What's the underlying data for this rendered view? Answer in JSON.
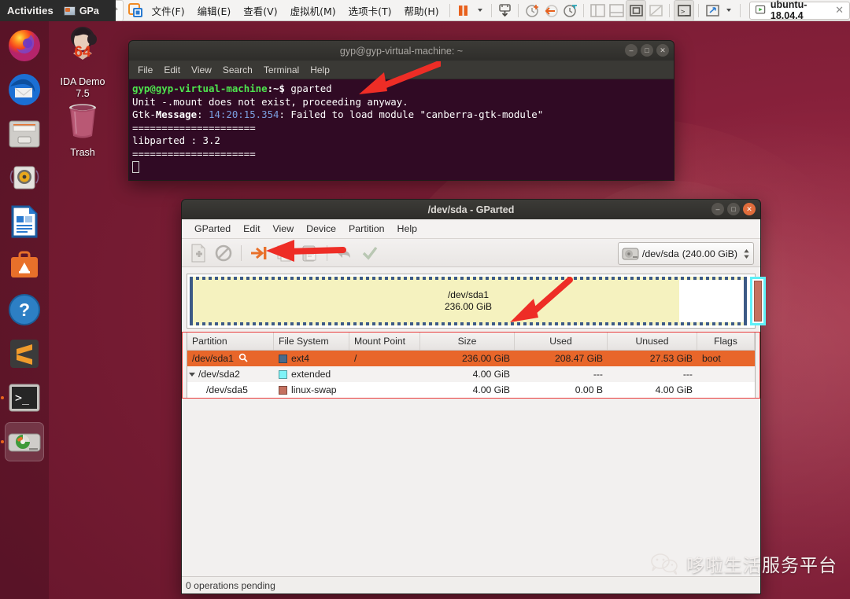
{
  "gnome_panel": {
    "activities": "Activities",
    "window_item": "GPa",
    "window_icon": "gparted-icon"
  },
  "vmware_toolbar": {
    "pin_icon": "pin-icon",
    "vmware_logo_icon": "vmware-logo-icon",
    "menus": [
      {
        "label": "文件(F)",
        "accel": "F"
      },
      {
        "label": "编辑(E)",
        "accel": "E"
      },
      {
        "label": "查看(V)",
        "accel": "V"
      },
      {
        "label": "虚拟机(M)",
        "accel": "M"
      },
      {
        "label": "选项卡(T)",
        "accel": "T"
      },
      {
        "label": "帮助(H)",
        "accel": "H"
      }
    ],
    "buttons": [
      {
        "name": "suspend-icon",
        "label": "Suspend"
      },
      {
        "name": "dropdown-caret-icon",
        "label": ""
      },
      {
        "name": "snapshot-icon",
        "label": "Take snapshot"
      },
      {
        "name": "manage-snapshots-icon",
        "label": "Manage snapshots"
      },
      {
        "name": "revert-snapshot-icon",
        "label": "Revert snapshot"
      },
      {
        "name": "snapshot-manager-icon",
        "label": "Snapshot manager"
      },
      {
        "name": "show-library-icon",
        "label": "Show library"
      },
      {
        "name": "show-thumbnails-icon",
        "label": "Show thumbnail bar"
      },
      {
        "name": "fullscreen-icon",
        "label": "Enter full screen"
      },
      {
        "name": "unity-mode-icon",
        "label": "Unity mode"
      },
      {
        "name": "console-icon",
        "label": "Console view"
      },
      {
        "name": "stretch-icon",
        "label": "Stretch guest"
      },
      {
        "name": "stretch-caret-icon",
        "label": ""
      }
    ],
    "tab": {
      "title": "ubuntu-18.04.4",
      "icon": "vm-running-icon",
      "close_icon": "close-icon"
    }
  },
  "dock": {
    "items": [
      {
        "name": "firefox",
        "label": "Firefox",
        "running": false
      },
      {
        "name": "thunderbird",
        "label": "Thunderbird Mail",
        "running": false
      },
      {
        "name": "files",
        "label": "Files",
        "running": false
      },
      {
        "name": "rhythmbox",
        "label": "Rhythmbox",
        "running": false
      },
      {
        "name": "libreoffice-writer",
        "label": "LibreOffice Writer",
        "running": false
      },
      {
        "name": "ubuntu-software",
        "label": "Ubuntu Software",
        "running": false
      },
      {
        "name": "help",
        "label": "Help",
        "running": false
      },
      {
        "name": "sublime-text",
        "label": "Sublime Text",
        "running": false
      },
      {
        "name": "terminal",
        "label": "Terminal",
        "running": true
      },
      {
        "name": "gparted",
        "label": "GParted",
        "running": true
      }
    ]
  },
  "desktop_icons": [
    {
      "name": "ida-demo",
      "label_line1": "IDA Demo",
      "label_line2": "7.5"
    },
    {
      "name": "trash",
      "label_line1": "Trash",
      "label_line2": ""
    }
  ],
  "terminal": {
    "title": "gyp@gyp-virtual-machine: ~",
    "menus": [
      "File",
      "Edit",
      "View",
      "Search",
      "Terminal",
      "Help"
    ],
    "prompt": "gyp@gyp-virtual-machine",
    "prompt_path": ":~$ ",
    "command": "gparted",
    "lines": [
      "Unit -.mount does not exist, proceeding anyway.",
      "=====================",
      "libparted : 3.2",
      "====================="
    ],
    "gtk_prefix": "Gtk-",
    "gtk_message_word": "Message",
    "gtk_time": "14:20:15.354",
    "gtk_rest": ": Failed to load module \"canberra-gtk-module\"",
    "window_buttons": [
      "minimize",
      "maximize",
      "close"
    ]
  },
  "gparted": {
    "title": "/dev/sda - GParted",
    "menus": [
      "GParted",
      "Edit",
      "View",
      "Device",
      "Partition",
      "Help"
    ],
    "toolbar": [
      {
        "name": "new-partition-icon",
        "label": "New",
        "enabled": false
      },
      {
        "name": "delete-partition-icon",
        "label": "Delete",
        "enabled": false
      },
      {
        "name": "resize-move-icon",
        "label": "Resize/Move",
        "enabled": true
      },
      {
        "name": "copy-icon",
        "label": "Copy",
        "enabled": false
      },
      {
        "name": "paste-icon",
        "label": "Paste",
        "enabled": false
      },
      {
        "name": "undo-icon",
        "label": "Undo",
        "enabled": false
      },
      {
        "name": "apply-icon",
        "label": "Apply",
        "enabled": false
      }
    ],
    "device_selector": {
      "icon": "harddisk-icon",
      "device": "/dev/sda",
      "size": "(240.00 GiB)",
      "spinner_icon": "spinner-updown-icon"
    },
    "graphic": {
      "partition_label": "/dev/sda1",
      "partition_size": "236.00 GiB",
      "used_gib": 208.47,
      "total_gib": 236.0,
      "extended_name": "/dev/sda2",
      "swap_name": "/dev/sda5"
    },
    "table": {
      "headers": [
        "Partition",
        "File System",
        "Mount Point",
        "Size",
        "Used",
        "Unused",
        "Flags"
      ],
      "rows": [
        {
          "partition": "/dev/sda1",
          "has_key_icon": true,
          "indent": 0,
          "expander": false,
          "fs": "ext4",
          "fs_color": "#4a6a8a",
          "mount": "/",
          "size": "236.00 GiB",
          "used": "208.47 GiB",
          "unused": "27.53 GiB",
          "flags": "boot",
          "selected": true
        },
        {
          "partition": "/dev/sda2",
          "has_key_icon": false,
          "indent": 0,
          "expander": true,
          "fs": "extended",
          "fs_color": "#7ff3f7",
          "mount": "",
          "size": "4.00 GiB",
          "used": "---",
          "unused": "---",
          "flags": "",
          "selected": false
        },
        {
          "partition": "/dev/sda5",
          "has_key_icon": false,
          "indent": 1,
          "expander": false,
          "fs": "linux-swap",
          "fs_color": "#c4705f",
          "mount": "",
          "size": "4.00 GiB",
          "used": "0.00 B",
          "unused": "4.00 GiB",
          "flags": "",
          "selected": false
        }
      ]
    },
    "status": "0 operations pending",
    "window_buttons": [
      "minimize",
      "maximize",
      "close"
    ]
  },
  "annotations": {
    "arrow_terminal": "red-arrow-pointing-to-terminal-prompt",
    "arrow_toolbar": "red-arrow-pointing-to-resize-move-button",
    "arrow_graphic": "red-arrow-pointing-to-partition-graphic",
    "box_table": "red-rectangle-around-partition-table",
    "accent_color": "#e8393a"
  },
  "watermark": {
    "text": "哆啦生活服务平台",
    "icon": "wechat-icon"
  }
}
